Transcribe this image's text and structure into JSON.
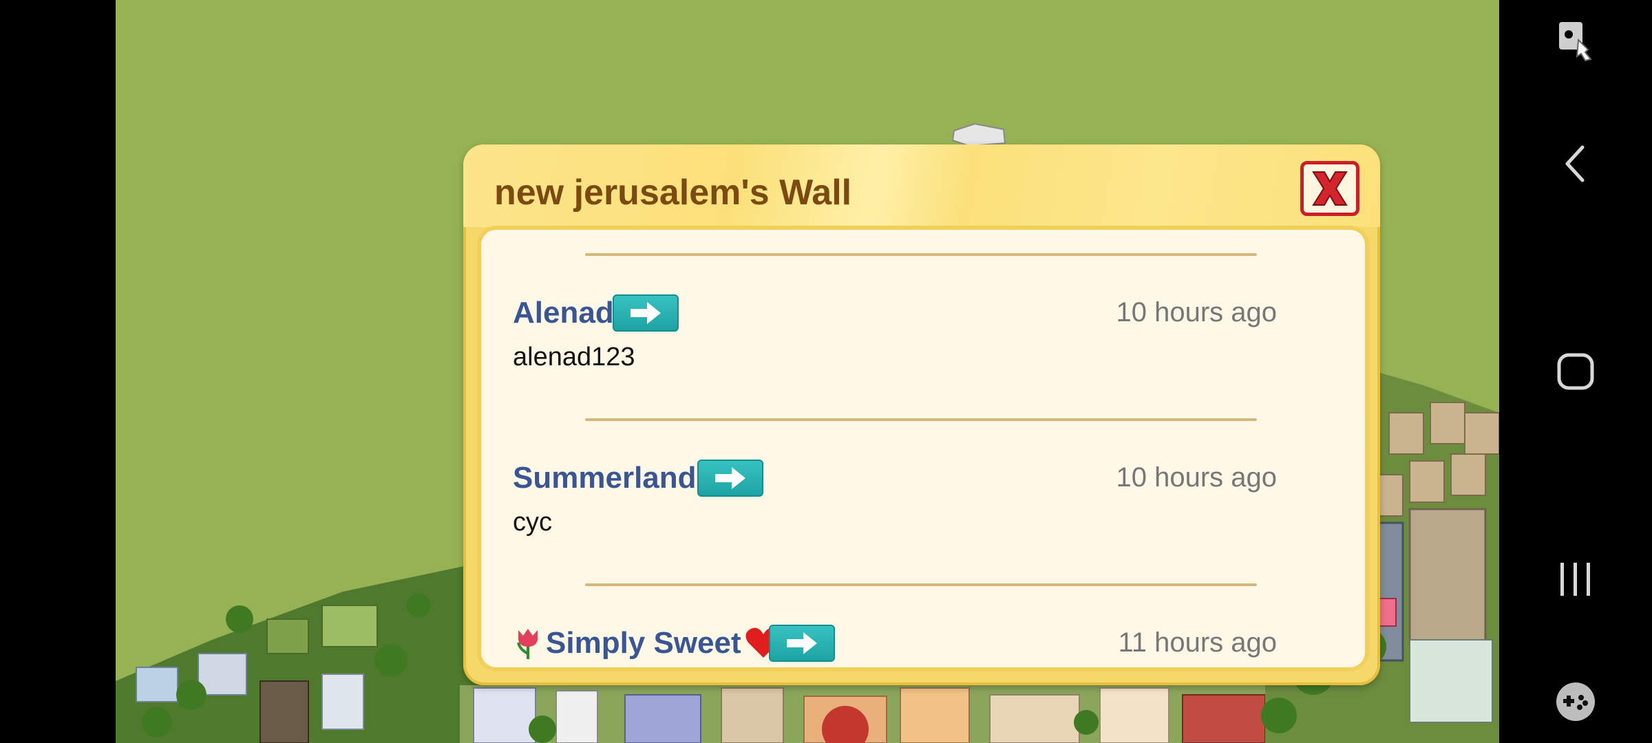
{
  "dialog": {
    "title": "new jerusalem's Wall",
    "close_icon": "close-x-icon"
  },
  "wall": {
    "entries": [
      {
        "author": "Alenad",
        "time": "10 hours ago",
        "message": "alenad123",
        "prefix_icon": "",
        "suffix_icon": ""
      },
      {
        "author": "Summerland",
        "time": "10 hours ago",
        "message": "cyc",
        "prefix_icon": "",
        "suffix_icon": ""
      },
      {
        "author": "Simply Sweet",
        "time": "11 hours ago",
        "message": "",
        "prefix_icon": "tulip-icon",
        "suffix_icon": "heart-icon"
      }
    ],
    "goto_icon": "arrow-right-icon"
  },
  "navbar": {
    "icons": [
      "screen-lock-icon",
      "back-icon",
      "home-icon",
      "recents-icon",
      "game-tools-icon"
    ]
  },
  "colors": {
    "background": "#96b254",
    "dialog_frame": "#f6d86a",
    "author": "#3a5593",
    "goto_button": "#22aaa8",
    "close": "#c8202a"
  }
}
